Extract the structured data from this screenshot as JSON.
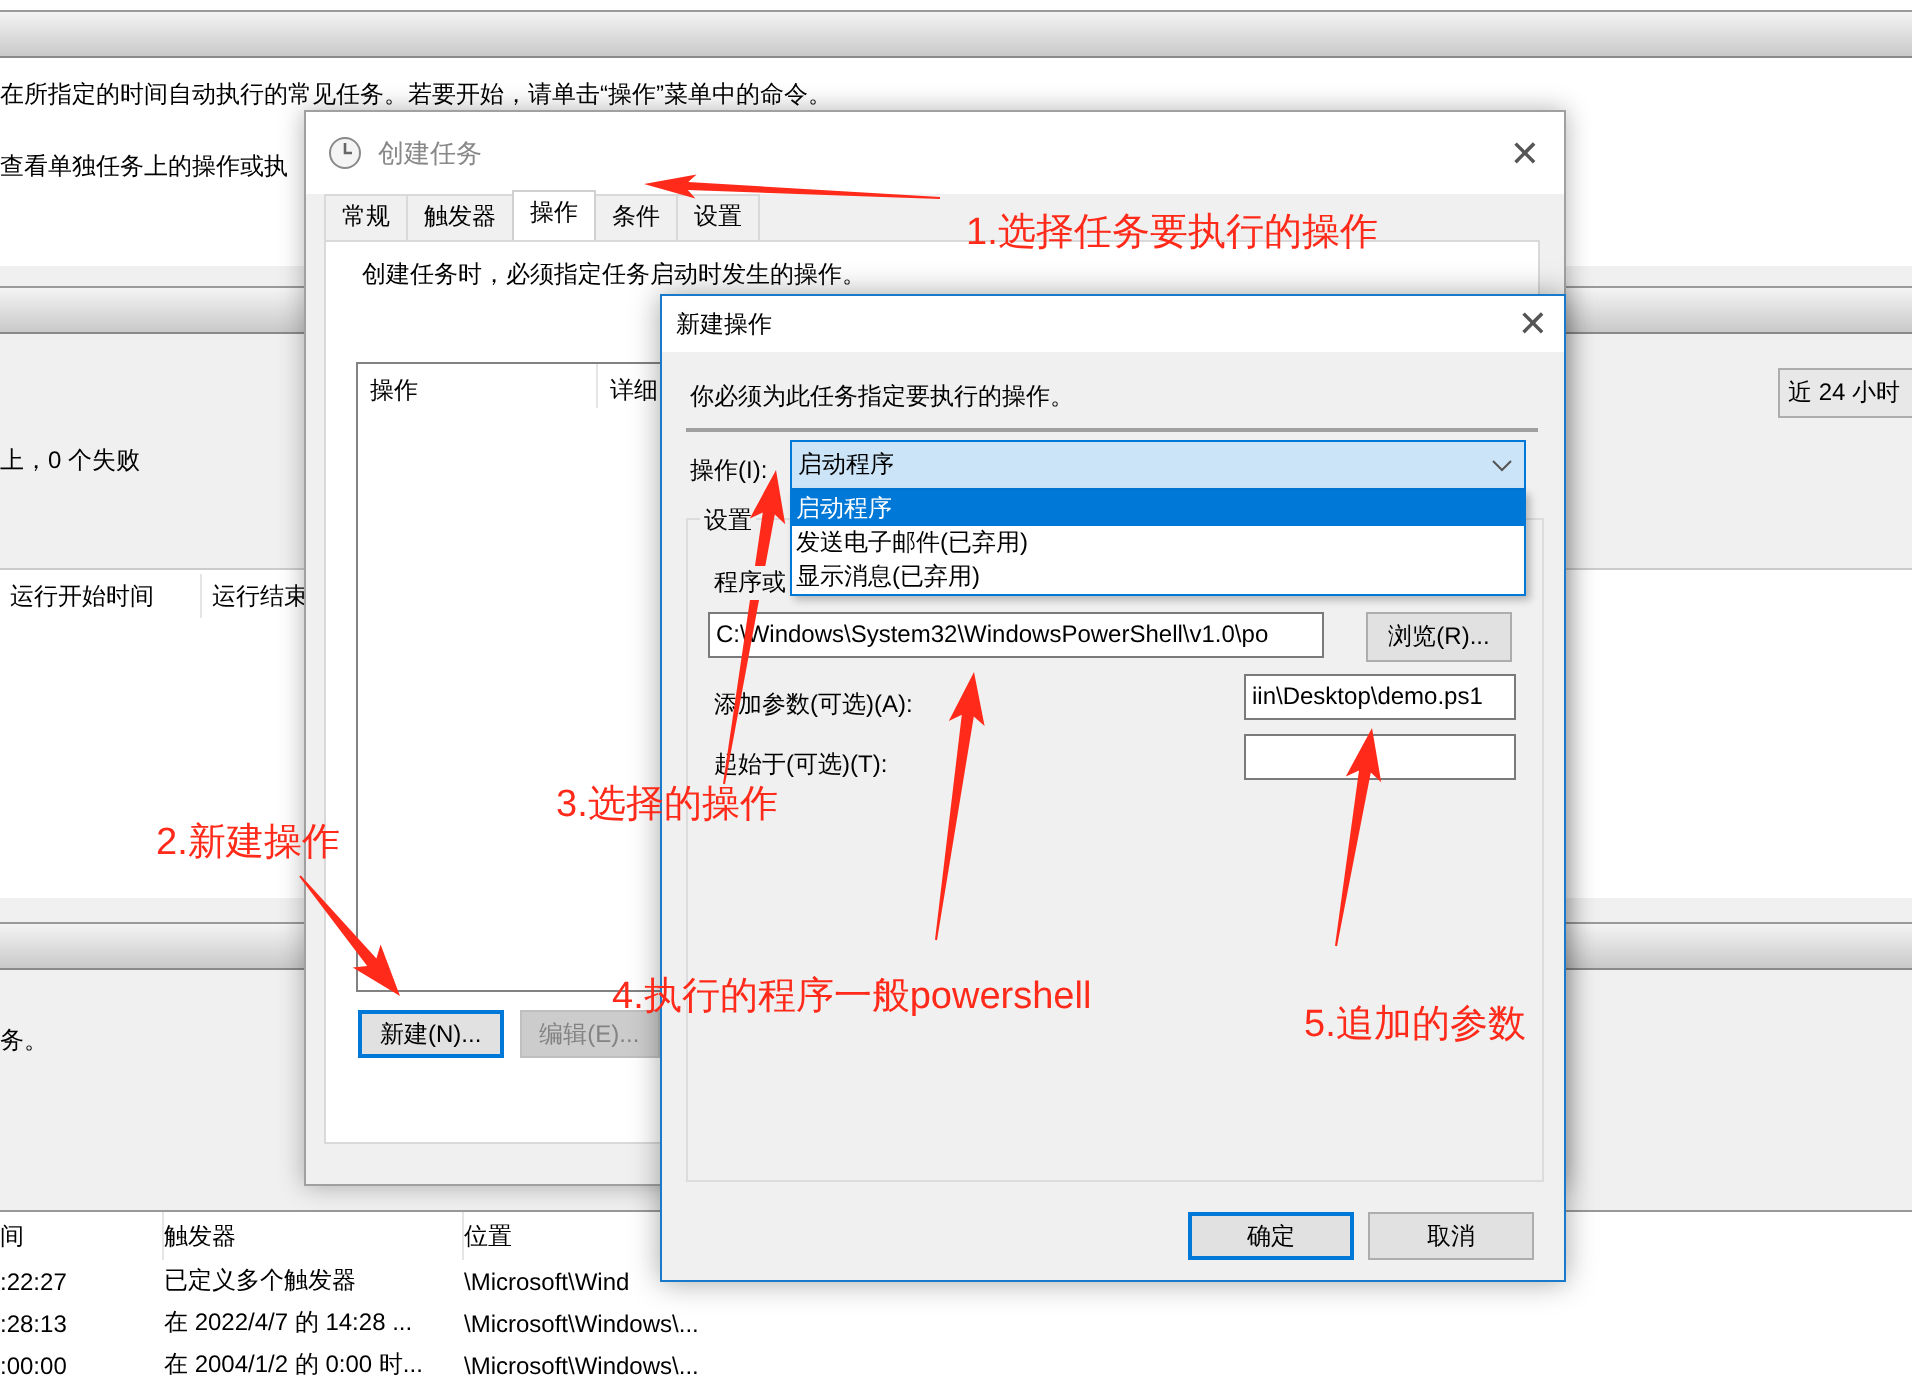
{
  "main_window": {
    "description": "在所指定的时间自动执行的常见任务。若要开始，请单击“操作”菜单中的命令。",
    "hint": "查看单独任务上的操作或执",
    "summary": "上，0 个失败",
    "range_dropdown": "近 24 小时",
    "history_columns": [
      "运行开始时间",
      "运行结束"
    ],
    "status_text": "务。",
    "task_columns": [
      "间",
      "触发器",
      "位置"
    ],
    "task_rows": [
      {
        "time": ":22:27",
        "trigger": "已定义多个触发器",
        "location": "\\Microsoft\\Wind"
      },
      {
        "time": ":28:13",
        "trigger": "在 2022/4/7 的 14:28 ...",
        "location": "\\Microsoft\\Windows\\..."
      },
      {
        "time": ":00:00",
        "trigger": "在 2004/1/2 的 0:00 时...",
        "location": "\\Microsoft\\Windows\\..."
      }
    ]
  },
  "create_task_dialog": {
    "title": "创建任务",
    "close_icon": "✕",
    "tabs": [
      {
        "label": "常规",
        "selected": false
      },
      {
        "label": "触发器",
        "selected": false
      },
      {
        "label": "操作",
        "selected": true
      },
      {
        "label": "条件",
        "selected": false
      },
      {
        "label": "设置",
        "selected": false
      }
    ],
    "description": "创建任务时，必须指定任务启动时发生的操作。",
    "list_columns": [
      "操作",
      "详细"
    ],
    "buttons": [
      {
        "label": "新建(N)...",
        "focused": true,
        "disabled": false
      },
      {
        "label": "编辑(E)...",
        "focused": false,
        "disabled": true
      }
    ]
  },
  "new_action_dialog": {
    "title": "新建操作",
    "close_icon": "✕",
    "instruction": "你必须为此任务指定要执行的操作。",
    "action_label": "操作(I):",
    "action_value": "启动程序",
    "options": [
      {
        "label": "启动程序",
        "selected": true
      },
      {
        "label": "发送电子邮件(已弃用)",
        "selected": false
      },
      {
        "label": "显示消息(已弃用)",
        "selected": false
      }
    ],
    "group_label": "设置",
    "program_label": "程序或",
    "program_value": "C:\\Windows\\System32\\WindowsPowerShell\\v1.0\\po",
    "browse_button": "浏览(R)...",
    "arguments_label": "添加参数(可选)(A):",
    "arguments_value": "iin\\Desktop\\demo.ps1",
    "start_in_label": "起始于(可选)(T):",
    "ok_button": "确定",
    "cancel_button": "取消"
  },
  "annotations": [
    {
      "text": "1.选择任务要执行的操作"
    },
    {
      "text": "2.新建操作"
    },
    {
      "text": "3.选择的操作"
    },
    {
      "text": "4.执行的程序一般powershell"
    },
    {
      "text": "5.追加的参数"
    }
  ]
}
